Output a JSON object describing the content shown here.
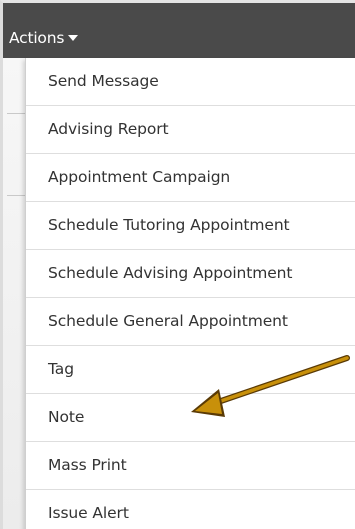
{
  "toolbar": {
    "actions_label": "Actions"
  },
  "menu": {
    "items": [
      {
        "label": "Send Message"
      },
      {
        "label": "Advising Report"
      },
      {
        "label": "Appointment Campaign"
      },
      {
        "label": "Schedule Tutoring Appointment"
      },
      {
        "label": "Schedule Advising Appointment"
      },
      {
        "label": "Schedule General Appointment"
      },
      {
        "label": "Tag"
      },
      {
        "label": "Note"
      },
      {
        "label": "Mass Print"
      },
      {
        "label": "Issue Alert"
      }
    ]
  },
  "annotation": {
    "arrow_color": "#c8900a",
    "arrow_target": "Note"
  },
  "colors": {
    "topbar": "#4a4a4a",
    "menu_text": "#333333"
  }
}
